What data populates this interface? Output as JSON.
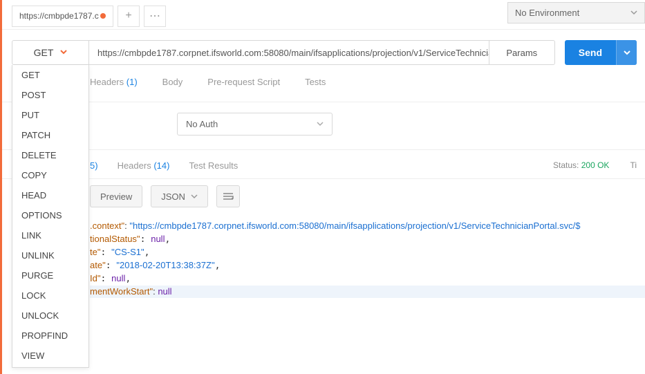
{
  "tab": {
    "title": "https://cmbpde1787.c"
  },
  "env": {
    "label": "No Environment"
  },
  "request": {
    "method": "GET",
    "url": "https://cmbpde1787.corpnet.ifsworld.com:58080/main/ifsapplications/projection/v1/ServiceTechnicia...",
    "params_label": "Params",
    "send_label": "Send"
  },
  "method_options": [
    "GET",
    "POST",
    "PUT",
    "PATCH",
    "DELETE",
    "COPY",
    "HEAD",
    "OPTIONS",
    "LINK",
    "UNLINK",
    "PURGE",
    "LOCK",
    "UNLOCK",
    "PROPFIND",
    "VIEW"
  ],
  "req_tabs": {
    "headers_lbl": "Headers",
    "headers_count": "(1)",
    "body_lbl": "Body",
    "prereq_lbl": "Pre-request Script",
    "tests_lbl": "Tests"
  },
  "auth": {
    "selected": "No Auth"
  },
  "resp_tabs": {
    "first_count": "5)",
    "headers_lbl": "Headers",
    "headers_count": "(14)",
    "testres_lbl": "Test Results"
  },
  "status": {
    "status_lbl": "Status:",
    "status_value": "200 OK",
    "time_lbl": "Ti"
  },
  "resp_toolbar": {
    "preview_lbl": "Preview",
    "format_lbl": "JSON"
  },
  "json": {
    "l1_key": ".context\"",
    "l1_sep": ": ",
    "l1_val": "\"https://cmbpde1787.corpnet.ifsworld.com:58080/main/ifsapplications/projection/v1/ServiceTechnicianPortal.svc/$",
    "l2_key": "tionalStatus\"",
    "l2_val": "null",
    "l3_key": "te\"",
    "l3_val": "\"CS-S1\"",
    "l4_key": "ate\"",
    "l4_val": "\"2018-02-20T13:38:37Z\"",
    "l5_key": "Id\"",
    "l5_val": "null",
    "l6_key": "mentWorkStart\"",
    "l6_val": "null"
  }
}
